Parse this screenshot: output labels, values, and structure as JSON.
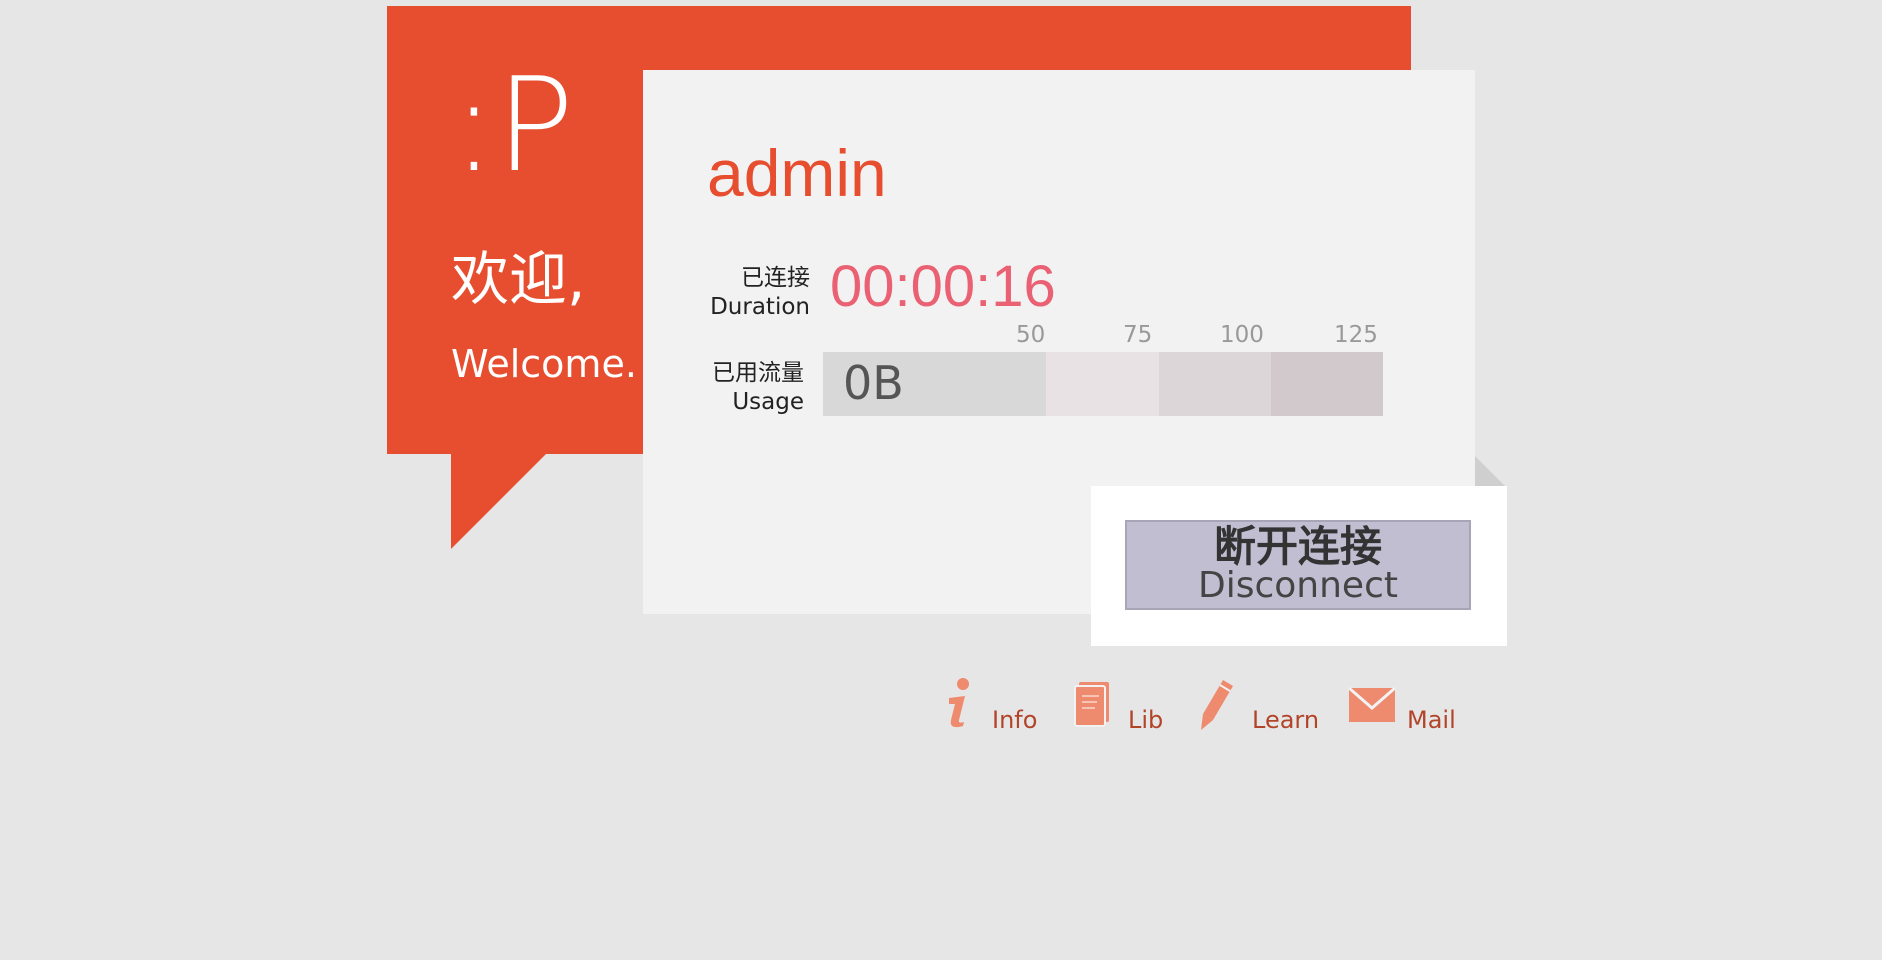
{
  "welcome": {
    "smiley": ":P",
    "cn": "欢迎,",
    "en": "Welcome."
  },
  "user": {
    "name": "admin"
  },
  "duration": {
    "label_cn": "已连接",
    "label_en": "Duration",
    "value": "00:00:16"
  },
  "usage": {
    "label_cn": "已用流量",
    "label_en": "Usage",
    "value": "0B",
    "ticks": [
      "50",
      "75",
      "100",
      "125"
    ]
  },
  "disconnect": {
    "label_cn": "断开连接",
    "label_en": "Disconnect"
  },
  "links": [
    {
      "label": "Info",
      "icon": "info-icon"
    },
    {
      "label": "Lib",
      "icon": "book-icon"
    },
    {
      "label": "Learn",
      "icon": "pencil-icon"
    },
    {
      "label": "Mail",
      "icon": "mail-icon"
    }
  ],
  "colors": {
    "accent": "#e64e2f",
    "duration": "#e96173",
    "link": "#b24429",
    "icon": "#ee8a6e",
    "button": "#c1bed2"
  }
}
